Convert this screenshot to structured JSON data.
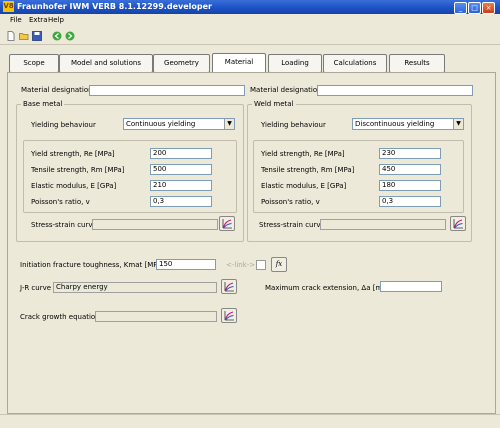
{
  "window": {
    "title": "Fraunhofer IWM VERB 8.1.12299.developer",
    "logo_text": "V8"
  },
  "menu": {
    "items": [
      "File",
      "Extra",
      "Help"
    ]
  },
  "tabs": [
    "Scope",
    "Model and solutions",
    "Geometry",
    "Material",
    "Loading",
    "Calculations",
    "Results"
  ],
  "active_tab": "Material",
  "material": {
    "designation_label": "Material designation",
    "base_designation_value": "",
    "weld_designation_value": ""
  },
  "base_metal": {
    "title": "Base metal",
    "yielding_label": "Yielding behaviour",
    "yielding_value": "Continuous yielding",
    "yield_label": "Yield strength, Re [MPa]",
    "yield_value": "200",
    "tensile_label": "Tensile strength, Rm [MPa]",
    "tensile_value": "500",
    "elastic_label": "Elastic modulus, E [GPa]",
    "elastic_value": "210",
    "poisson_label": "Poisson's ratio, v",
    "poisson_value": "0,3",
    "ss_label": "Stress-strain curve",
    "ss_value": ""
  },
  "weld_metal": {
    "title": "Weld metal",
    "yielding_label": "Yielding behaviour",
    "yielding_value": "Discontinuous yielding",
    "yield_label": "Yield strength, Re [MPa]",
    "yield_value": "230",
    "tensile_label": "Tensile strength, Rm [MPa]",
    "tensile_value": "450",
    "elastic_label": "Elastic modulus, E  [GPa]",
    "elastic_value": "180",
    "poisson_label": "Poisson's ratio, v",
    "poisson_value": "0,3",
    "ss_label": "Stress-strain curve",
    "ss_value": ""
  },
  "fracture": {
    "kmat_label": "Initiation fracture toughness, Kmat [MPa√m]",
    "kmat_value": "150",
    "link_label": "<-link->",
    "fx_label": "fx",
    "jr_label": "J-R curve",
    "jr_value": "Charpy energy",
    "max_crack_label": "Maximum crack extension, Δa [mm]",
    "max_crack_value": "",
    "crack_growth_label": "Crack growth equation",
    "crack_growth_value": ""
  }
}
